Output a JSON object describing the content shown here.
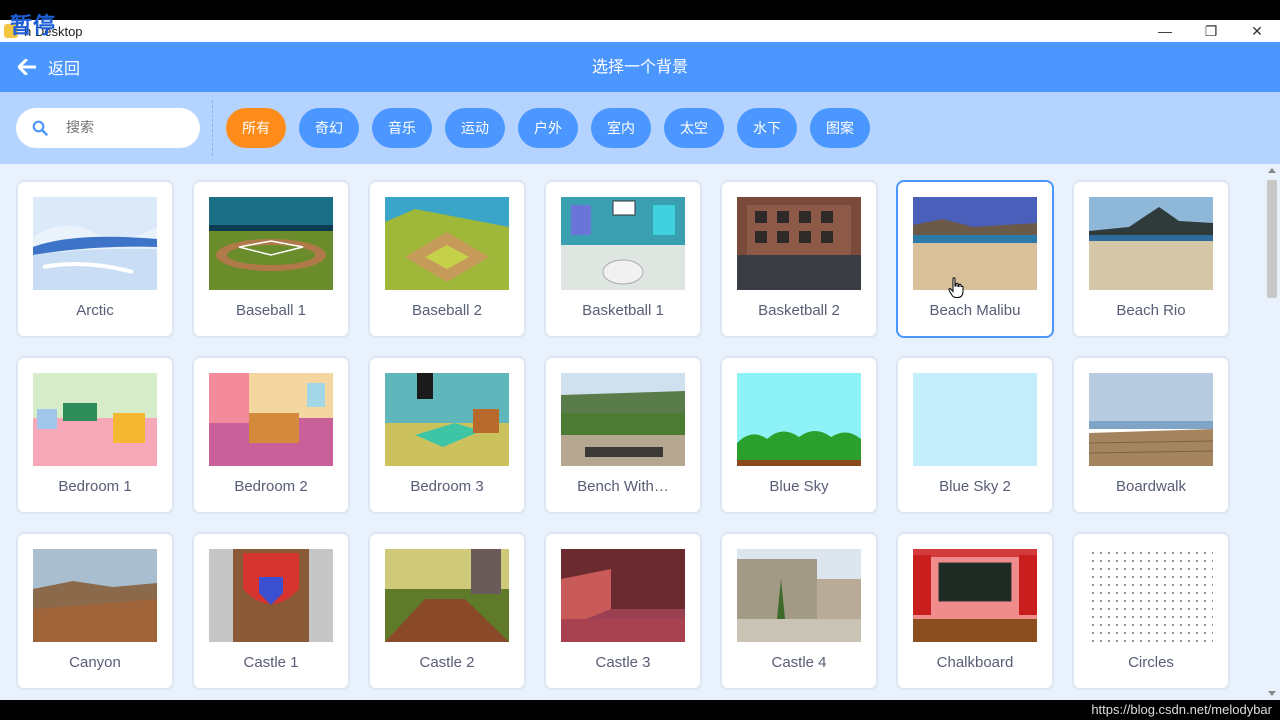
{
  "overlay": {
    "text": "暂停"
  },
  "window": {
    "title": "Scratch Desktop",
    "title_visible": "h Desktop",
    "controls": {
      "minimize": "—",
      "restore": "❐",
      "close": "✕"
    }
  },
  "header": {
    "back_label": "返回",
    "title": "选择一个背景"
  },
  "search": {
    "placeholder": "搜索"
  },
  "tags": [
    {
      "label": "所有",
      "active": true
    },
    {
      "label": "奇幻"
    },
    {
      "label": "音乐"
    },
    {
      "label": "运动"
    },
    {
      "label": "户外"
    },
    {
      "label": "室内"
    },
    {
      "label": "太空"
    },
    {
      "label": "水下"
    },
    {
      "label": "图案"
    }
  ],
  "backdrops": [
    {
      "name": "Arctic"
    },
    {
      "name": "Baseball 1"
    },
    {
      "name": "Baseball 2"
    },
    {
      "name": "Basketball 1"
    },
    {
      "name": "Basketball 2"
    },
    {
      "name": "Beach Malibu",
      "selected": true
    },
    {
      "name": "Beach Rio"
    },
    {
      "name": "Bedroom 1"
    },
    {
      "name": "Bedroom 2"
    },
    {
      "name": "Bedroom 3"
    },
    {
      "name": "Bench With…"
    },
    {
      "name": "Blue Sky"
    },
    {
      "name": "Blue Sky 2"
    },
    {
      "name": "Boardwalk"
    },
    {
      "name": "Canyon"
    },
    {
      "name": "Castle 1"
    },
    {
      "name": "Castle 2"
    },
    {
      "name": "Castle 3"
    },
    {
      "name": "Castle 4"
    },
    {
      "name": "Chalkboard"
    },
    {
      "name": "Circles"
    }
  ],
  "watermark": "https://blog.csdn.net/melodybar",
  "colors": {
    "accent": "#4c97ff",
    "active_tag": "#ff8c1a",
    "filter_bar": "#b4d3ff",
    "card_text": "#575e75"
  }
}
